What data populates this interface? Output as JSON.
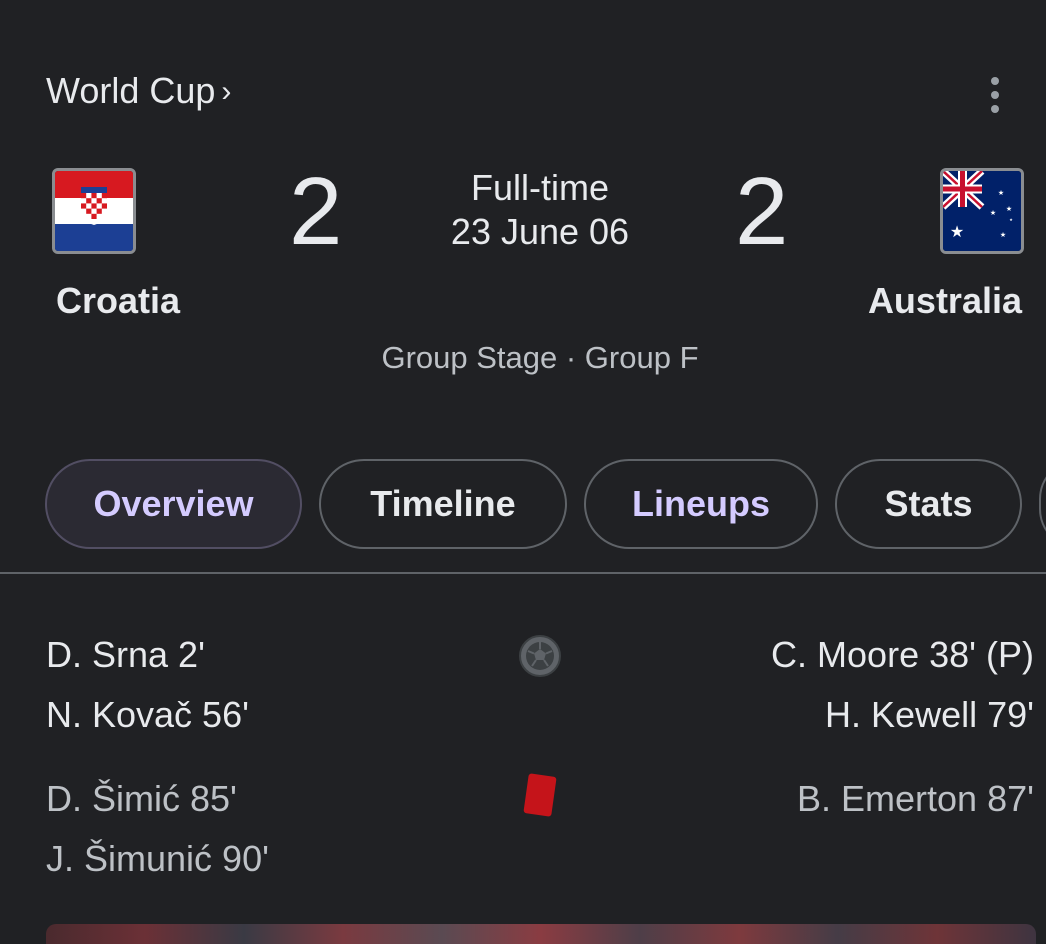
{
  "match": {
    "competition": "World Cup",
    "competition_chevron": "›",
    "status": "Full-time",
    "date": "23 June 06",
    "stage": "Group Stage · Group F"
  },
  "home": {
    "name": "Croatia",
    "score": "2",
    "flag_icon": "croatia-flag"
  },
  "away": {
    "name": "Australia",
    "score": "2",
    "flag_icon": "australia-flag"
  },
  "tabs": [
    {
      "label": "Overview",
      "active": true
    },
    {
      "label": "Timeline",
      "active": false
    },
    {
      "label": "Lineups",
      "active": false
    },
    {
      "label": "Stats",
      "active": false
    }
  ],
  "goals": {
    "icon": "soccer-ball-icon",
    "home": [
      "D. Srna 2'",
      "N. Kovač 56'"
    ],
    "away": [
      "C. Moore 38' (P)",
      "H. Kewell 79'"
    ]
  },
  "red_cards": {
    "icon": "red-card-icon",
    "home": [
      "D. Šimić 85'",
      "J. Šimunić 90'"
    ],
    "away": [
      "B. Emerton 87'"
    ]
  },
  "colors": {
    "background": "#202124",
    "text": "#e8eaed",
    "muted": "#bdc1c6",
    "accent_tab_text": "#d4cbff",
    "red_card": "#c5141a"
  }
}
